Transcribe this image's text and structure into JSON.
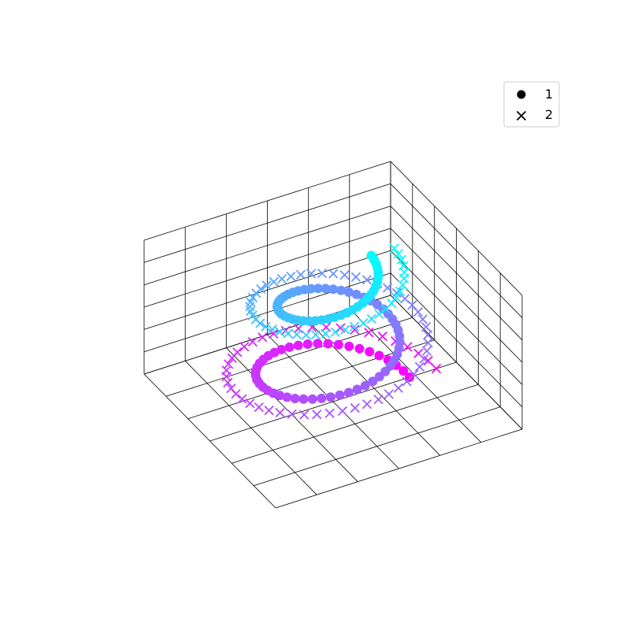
{
  "chart_data": {
    "type": "scatter",
    "projection": "3d",
    "title": "",
    "xlabel": "",
    "ylabel": "",
    "zlabel": "",
    "grid": true,
    "ticks_labeled": false,
    "colormap": "cool",
    "color_range": [
      "#ff00ff",
      "#00ffff"
    ],
    "xlim": [
      -1,
      1
    ],
    "ylim": [
      -1,
      1
    ],
    "zlim": [
      0,
      1
    ],
    "legend": {
      "placement": "upper-right",
      "entries": [
        {
          "label": "1",
          "marker": "circle"
        },
        {
          "label": "2",
          "marker": "x"
        }
      ]
    },
    "series": [
      {
        "name": "1",
        "marker": "circle",
        "count": 100,
        "shape": "helix",
        "turns": 2.0,
        "radius_start": 1.0,
        "radius_end": 0.5,
        "z_range": [
          0,
          1
        ]
      },
      {
        "name": "2",
        "marker": "x",
        "count": 100,
        "shape": "helix",
        "turns": 2.0,
        "radius_start": 1.35,
        "radius_end": 0.8,
        "z_range": [
          0,
          1
        ]
      }
    ]
  }
}
